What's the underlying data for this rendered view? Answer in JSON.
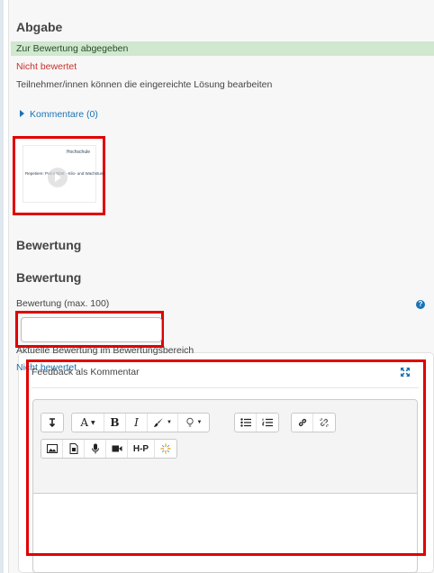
{
  "submission": {
    "heading": "Abgabe",
    "status": "Zur Bewertung abgegeben",
    "grading_status": "Nicht bewertet",
    "edit_note": "Teilnehmer/innen können die eingereichte Lösung bearbeiten",
    "comments_link": "Kommentare (0)"
  },
  "thumbnail": {
    "text": "Repetiere: Poti erklärt - Kilo- und Wachstum",
    "logo_text": "Hochschule"
  },
  "grading": {
    "heading": "Bewertung",
    "subheading": "Bewertung",
    "grade_label": "Bewertung (max. 100)",
    "grade_value": "",
    "current_label": "Aktuelle Bewertung im Bewertungsbereich",
    "current_value": "Nicht bewertet"
  },
  "feedback": {
    "label": "Feedback als Kommentar",
    "toolbar": {
      "font_label": "A",
      "bold_label": "B",
      "italic_label": "I",
      "h5p_label": "H-P"
    }
  },
  "colors": {
    "accent": "#1a73b5",
    "success_bg": "#cfe8cf",
    "error": "#c9302c",
    "highlight": "#e00000"
  },
  "icons": [
    "collapse-icon",
    "font-size-icon",
    "bold-icon",
    "italic-icon",
    "brush-icon",
    "bulb-icon",
    "bullet-list-icon",
    "numbered-list-icon",
    "link-icon",
    "unlink-icon",
    "image-icon",
    "document-icon",
    "microphone-icon",
    "video-icon",
    "h5p-icon",
    "sparkle-icon",
    "expand-icon",
    "help-icon"
  ]
}
